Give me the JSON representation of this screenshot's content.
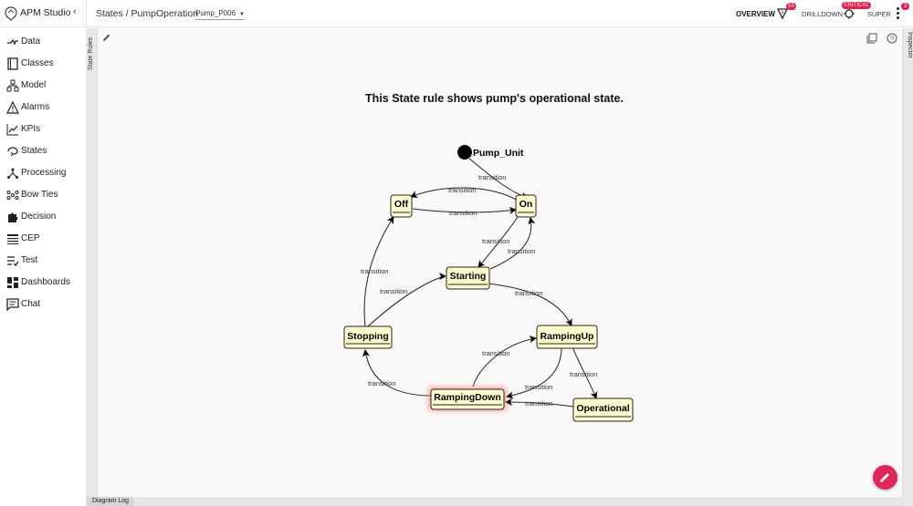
{
  "app": {
    "name": "APM Studio",
    "collapse_glyph": "‹"
  },
  "sidebar": {
    "items": [
      {
        "label": "Data",
        "icon": "data-flow-icon"
      },
      {
        "label": "Classes",
        "icon": "book-icon"
      },
      {
        "label": "Model",
        "icon": "hierarchy-icon"
      },
      {
        "label": "Alarms",
        "icon": "warning-icon"
      },
      {
        "label": "KPIs",
        "icon": "trend-icon"
      },
      {
        "label": "States",
        "icon": "cycle-icon"
      },
      {
        "label": "Processing",
        "icon": "branch-icon"
      },
      {
        "label": "Bow Ties",
        "icon": "bowtie-icon"
      },
      {
        "label": "Decision",
        "icon": "puzzle-icon"
      },
      {
        "label": "CEP",
        "icon": "table-icon"
      },
      {
        "label": "Test",
        "icon": "checklist-icon"
      },
      {
        "label": "Dashboards",
        "icon": "dashboard-icon"
      },
      {
        "label": "Chat",
        "icon": "chat-icon"
      }
    ]
  },
  "header": {
    "breadcrumb": "States / PumpOperation",
    "instance": "Pump_P006",
    "overview": "OVERVIEW",
    "overview_badge": "55",
    "drilldown": "DRILLDOWN",
    "critical_badge": "CRITICAL",
    "user": "SUPER",
    "user_badge": "3"
  },
  "panels": {
    "left_tab": "State Rules",
    "right_tab": "Inspector",
    "bottom_tab": "Diagram Log"
  },
  "diagram": {
    "title": "This State rule shows pump's operational state.",
    "initial": "Pump_Unit",
    "states": [
      "Off",
      "On",
      "Starting",
      "Stopping",
      "RampingUp",
      "RampingDown",
      "Operational"
    ],
    "active_state": "RampingDown",
    "transition_label": "transition"
  },
  "colors": {
    "accent": "#e3265a",
    "state_fill": "#fefece",
    "state_border": "#a80036",
    "active_glow": "#ff6b6b"
  }
}
